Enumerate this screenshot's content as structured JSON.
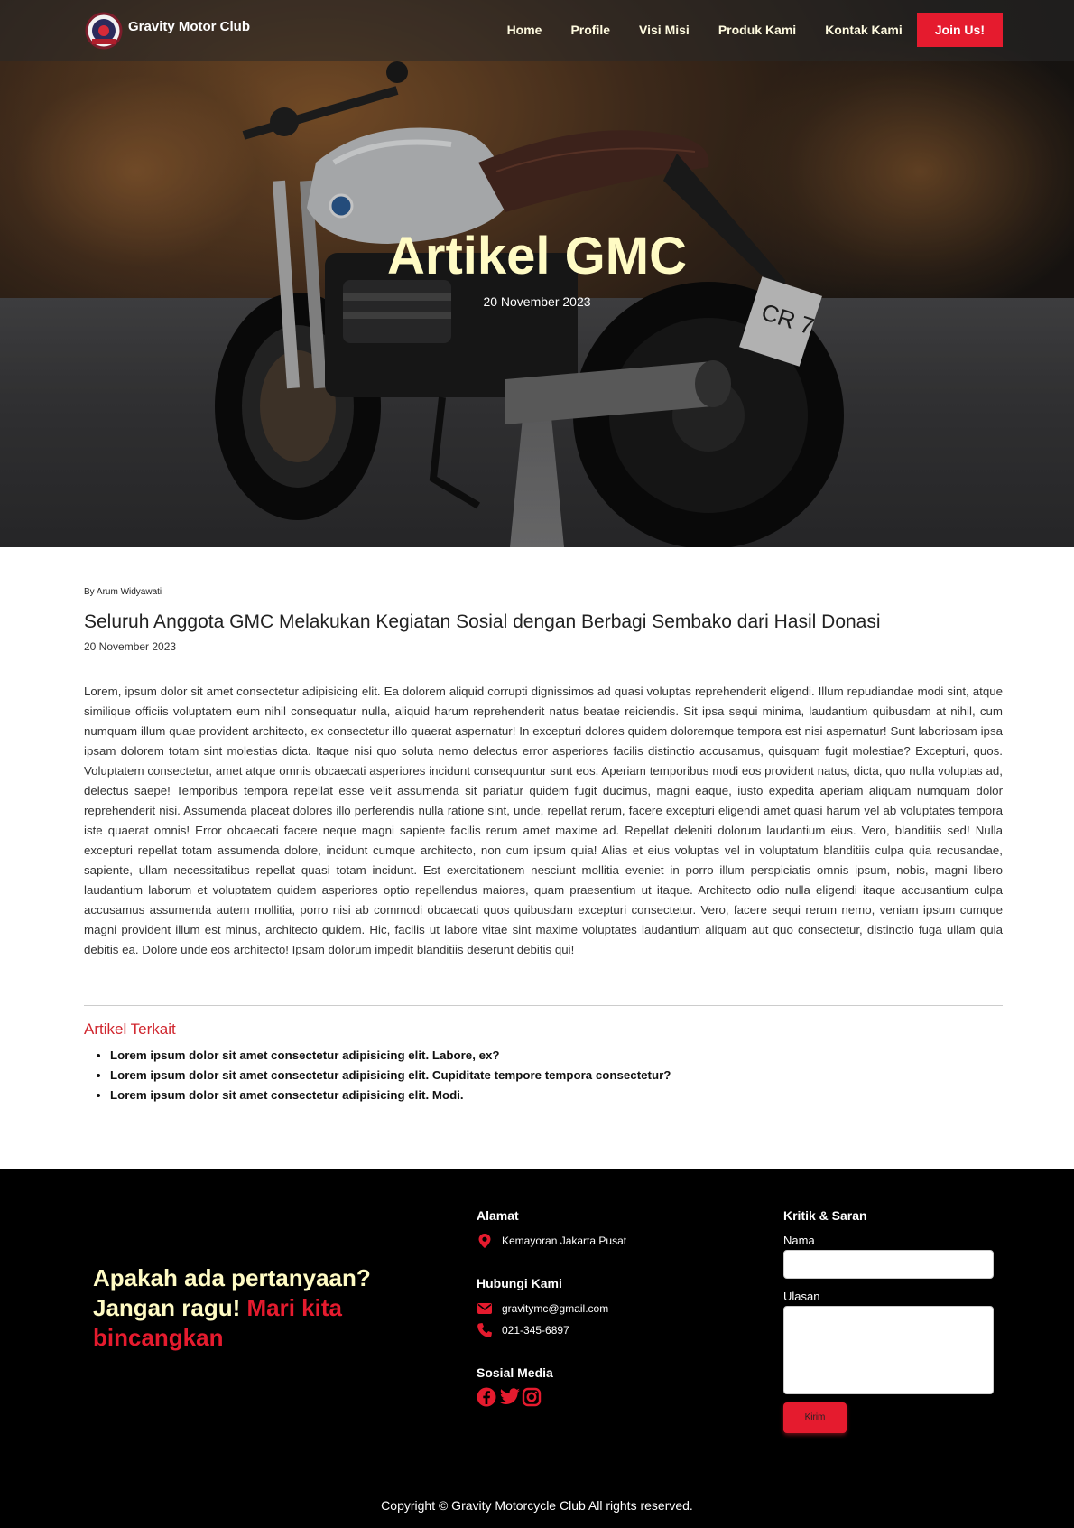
{
  "brand": {
    "name": "Gravity Motor Club",
    "logo_icon": "gmc-logo-icon"
  },
  "nav": {
    "items": [
      "Home",
      "Profile",
      "Visi Misi",
      "Produk Kami",
      "Kontak Kami"
    ],
    "join_label": "Join Us!"
  },
  "hero": {
    "title": "Artikel GMC",
    "date": "20 November 2023"
  },
  "article": {
    "author": "By Arum Widyawati",
    "title": "Seluruh Anggota GMC Melakukan Kegiatan Sosial dengan Berbagi Sembako dari Hasil Donasi",
    "date": "20 November 2023",
    "body": "Lorem, ipsum dolor sit amet consectetur adipisicing elit. Ea dolorem aliquid corrupti dignissimos ad quasi voluptas reprehenderit eligendi. Illum repudiandae modi sint, atque similique officiis voluptatem eum nihil consequatur nulla, aliquid harum reprehenderit natus beatae reiciendis. Sit ipsa sequi minima, laudantium quibusdam at nihil, cum numquam illum quae provident architecto, ex consectetur illo quaerat aspernatur! In excepturi dolores quidem doloremque tempora est nisi aspernatur! Sunt laboriosam ipsa ipsam dolorem totam sint molestias dicta. Itaque nisi quo soluta nemo delectus error asperiores facilis distinctio accusamus, quisquam fugit molestiae? Excepturi, quos. Voluptatem consectetur, amet atque omnis obcaecati asperiores incidunt consequuntur sunt eos. Aperiam temporibus modi eos provident natus, dicta, quo nulla voluptas ad, delectus saepe! Temporibus tempora repellat esse velit assumenda sit pariatur quidem fugit ducimus, magni eaque, iusto expedita aperiam aliquam numquam dolor reprehenderit nisi. Assumenda placeat dolores illo perferendis nulla ratione sint, unde, repellat rerum, facere excepturi eligendi amet quasi harum vel ab voluptates tempora iste quaerat omnis! Error obcaecati facere neque magni sapiente facilis rerum amet maxime ad. Repellat deleniti dolorum laudantium eius. Vero, blanditiis sed! Nulla excepturi repellat totam assumenda dolore, incidunt cumque architecto, non cum ipsum quia! Alias et eius voluptas vel in voluptatum blanditiis culpa quia recusandae, sapiente, ullam necessitatibus repellat quasi totam incidunt. Est exercitationem nesciunt mollitia eveniet in porro illum perspiciatis omnis ipsum, nobis, magni libero laudantium laborum et voluptatem quidem asperiores optio repellendus maiores, quam praesentium ut itaque. Architecto odio nulla eligendi itaque accusantium culpa accusamus assumenda autem mollitia, porro nisi ab commodi obcaecati quos quibusdam excepturi consectetur. Vero, facere sequi rerum nemo, veniam ipsum cumque magni provident illum est minus, architecto quidem. Hic, facilis ut labore vitae sint maxime voluptates laudantium aliquam aut quo consectetur, distinctio fuga ullam quia debitis ea. Dolore unde eos architecto! Ipsam dolorum impedit blanditiis deserunt debitis qui!"
  },
  "related": {
    "title": "Artikel Terkait",
    "items": [
      "Lorem ipsum dolor sit amet consectetur adipisicing elit. Labore, ex?",
      "Lorem ipsum dolor sit amet consectetur adipisicing elit. Cupiditate tempore tempora consectetur?",
      "Lorem ipsum dolor sit amet consectetur adipisicing elit. Modi."
    ]
  },
  "footer": {
    "cta_line1": "Apakah ada pertanyaan?",
    "cta_line2": "Jangan ragu!",
    "cta_highlight": "Mari kita bincangkan",
    "address_heading": "Alamat",
    "address": "Kemayoran Jakarta Pusat",
    "contact_heading": "Hubungi Kami",
    "email": "gravitymc@gmail.com",
    "phone": "021-345-6897",
    "social_heading": "Sosial Media",
    "social_icons": [
      "facebook-icon",
      "twitter-icon",
      "instagram-icon"
    ],
    "form_heading": "Kritik & Saran",
    "name_label": "Nama",
    "review_label": "Ulasan",
    "submit_label": "Kirim",
    "copyright": "Copyright © Gravity Motorcycle Club All rights reserved."
  },
  "colors": {
    "accent_red": "#e51b2e",
    "heading_cream": "#fffbc4",
    "footer_bg": "#000000"
  }
}
